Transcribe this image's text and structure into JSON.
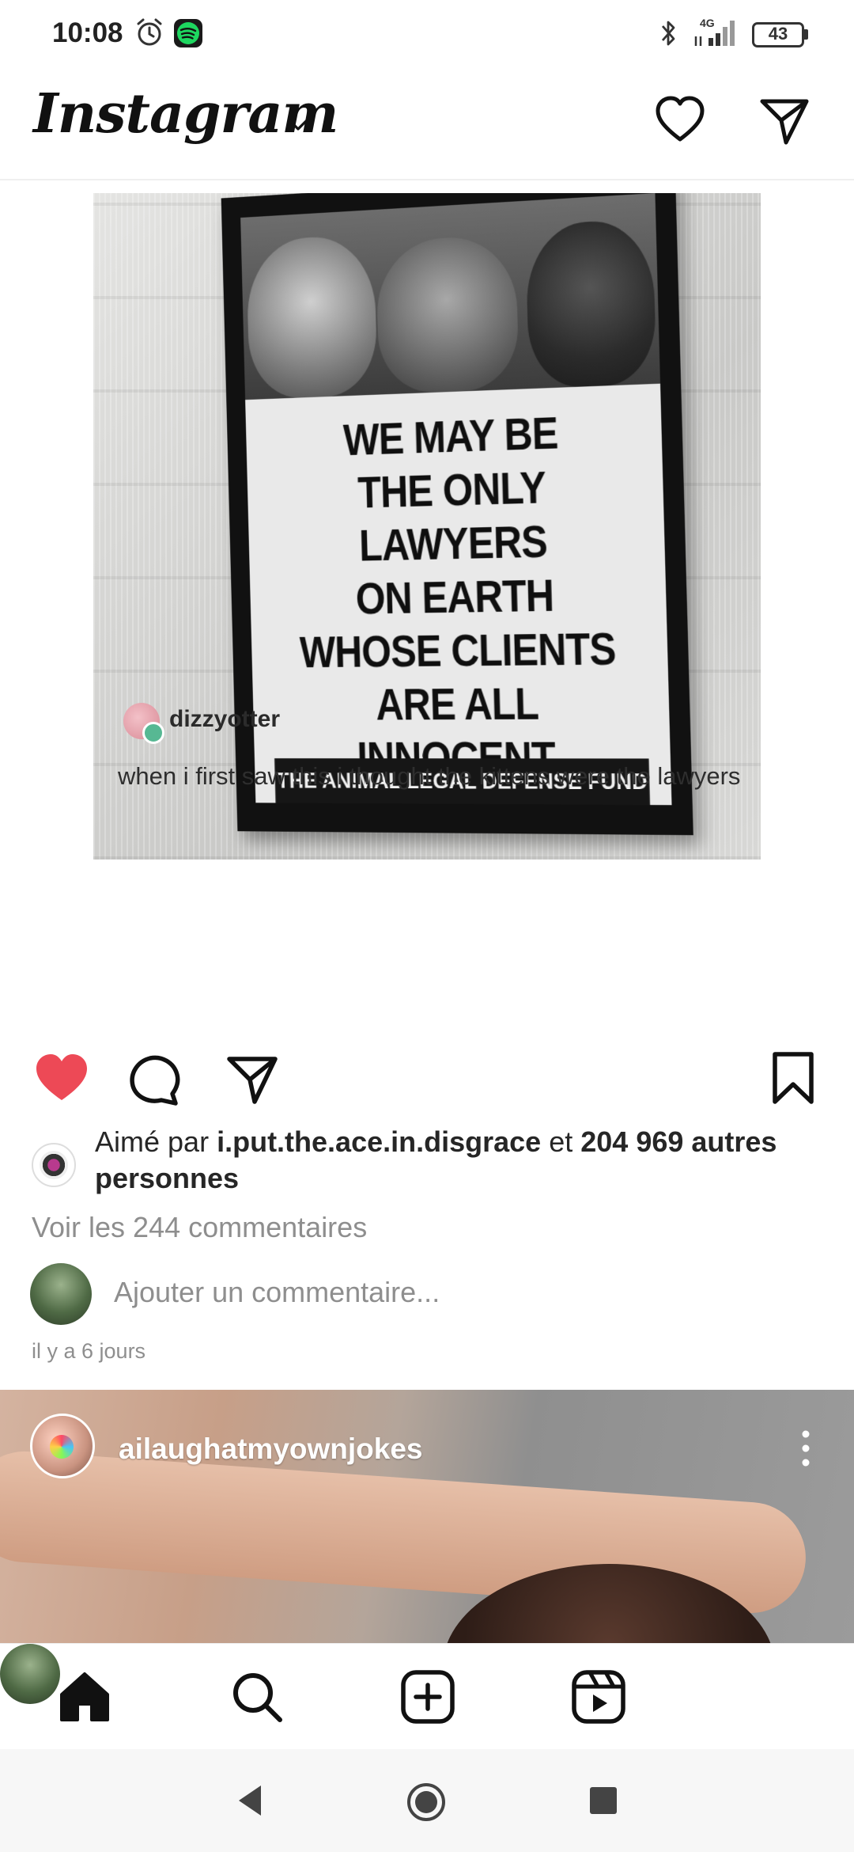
{
  "status_bar": {
    "time": "10:08",
    "network_label": "4G",
    "battery": "43"
  },
  "header": {
    "logo": "Instagram"
  },
  "post": {
    "poster": {
      "lines": [
        "WE MAY BE",
        "THE ONLY LAWYERS",
        "ON EARTH",
        "WHOSE CLIENTS",
        "ARE ALL",
        "INNOCENT."
      ],
      "footer": "THE ANIMAL LEGAL DEFENSE FUND"
    },
    "repost": {
      "username": "dizzyotter",
      "caption": "when i first saw this i thought the kittens were the lawyers"
    },
    "liked_by_prefix": "Aimé par",
    "liked_by_user": "i.put.the.ace.in.disgrace",
    "liked_by_and": "et",
    "liked_by_others": "204 969 autres personnes",
    "view_comments": "Voir les 244 commentaires",
    "comment_placeholder": "Ajouter un commentaire...",
    "time_ago": "il y a 6 jours"
  },
  "next_post": {
    "username": "ailaughatmyownjokes"
  },
  "colors": {
    "like_red": "#ed4956",
    "muted_text": "#8e8e8e",
    "text": "#262626"
  },
  "icons": {
    "header": [
      "heart-icon",
      "send-icon"
    ],
    "actions": [
      "heart-filled-icon",
      "comment-icon",
      "share-icon",
      "bookmark-icon"
    ],
    "nav": [
      "home-icon",
      "search-icon",
      "add-icon",
      "reels-icon",
      "profile-avatar"
    ]
  }
}
